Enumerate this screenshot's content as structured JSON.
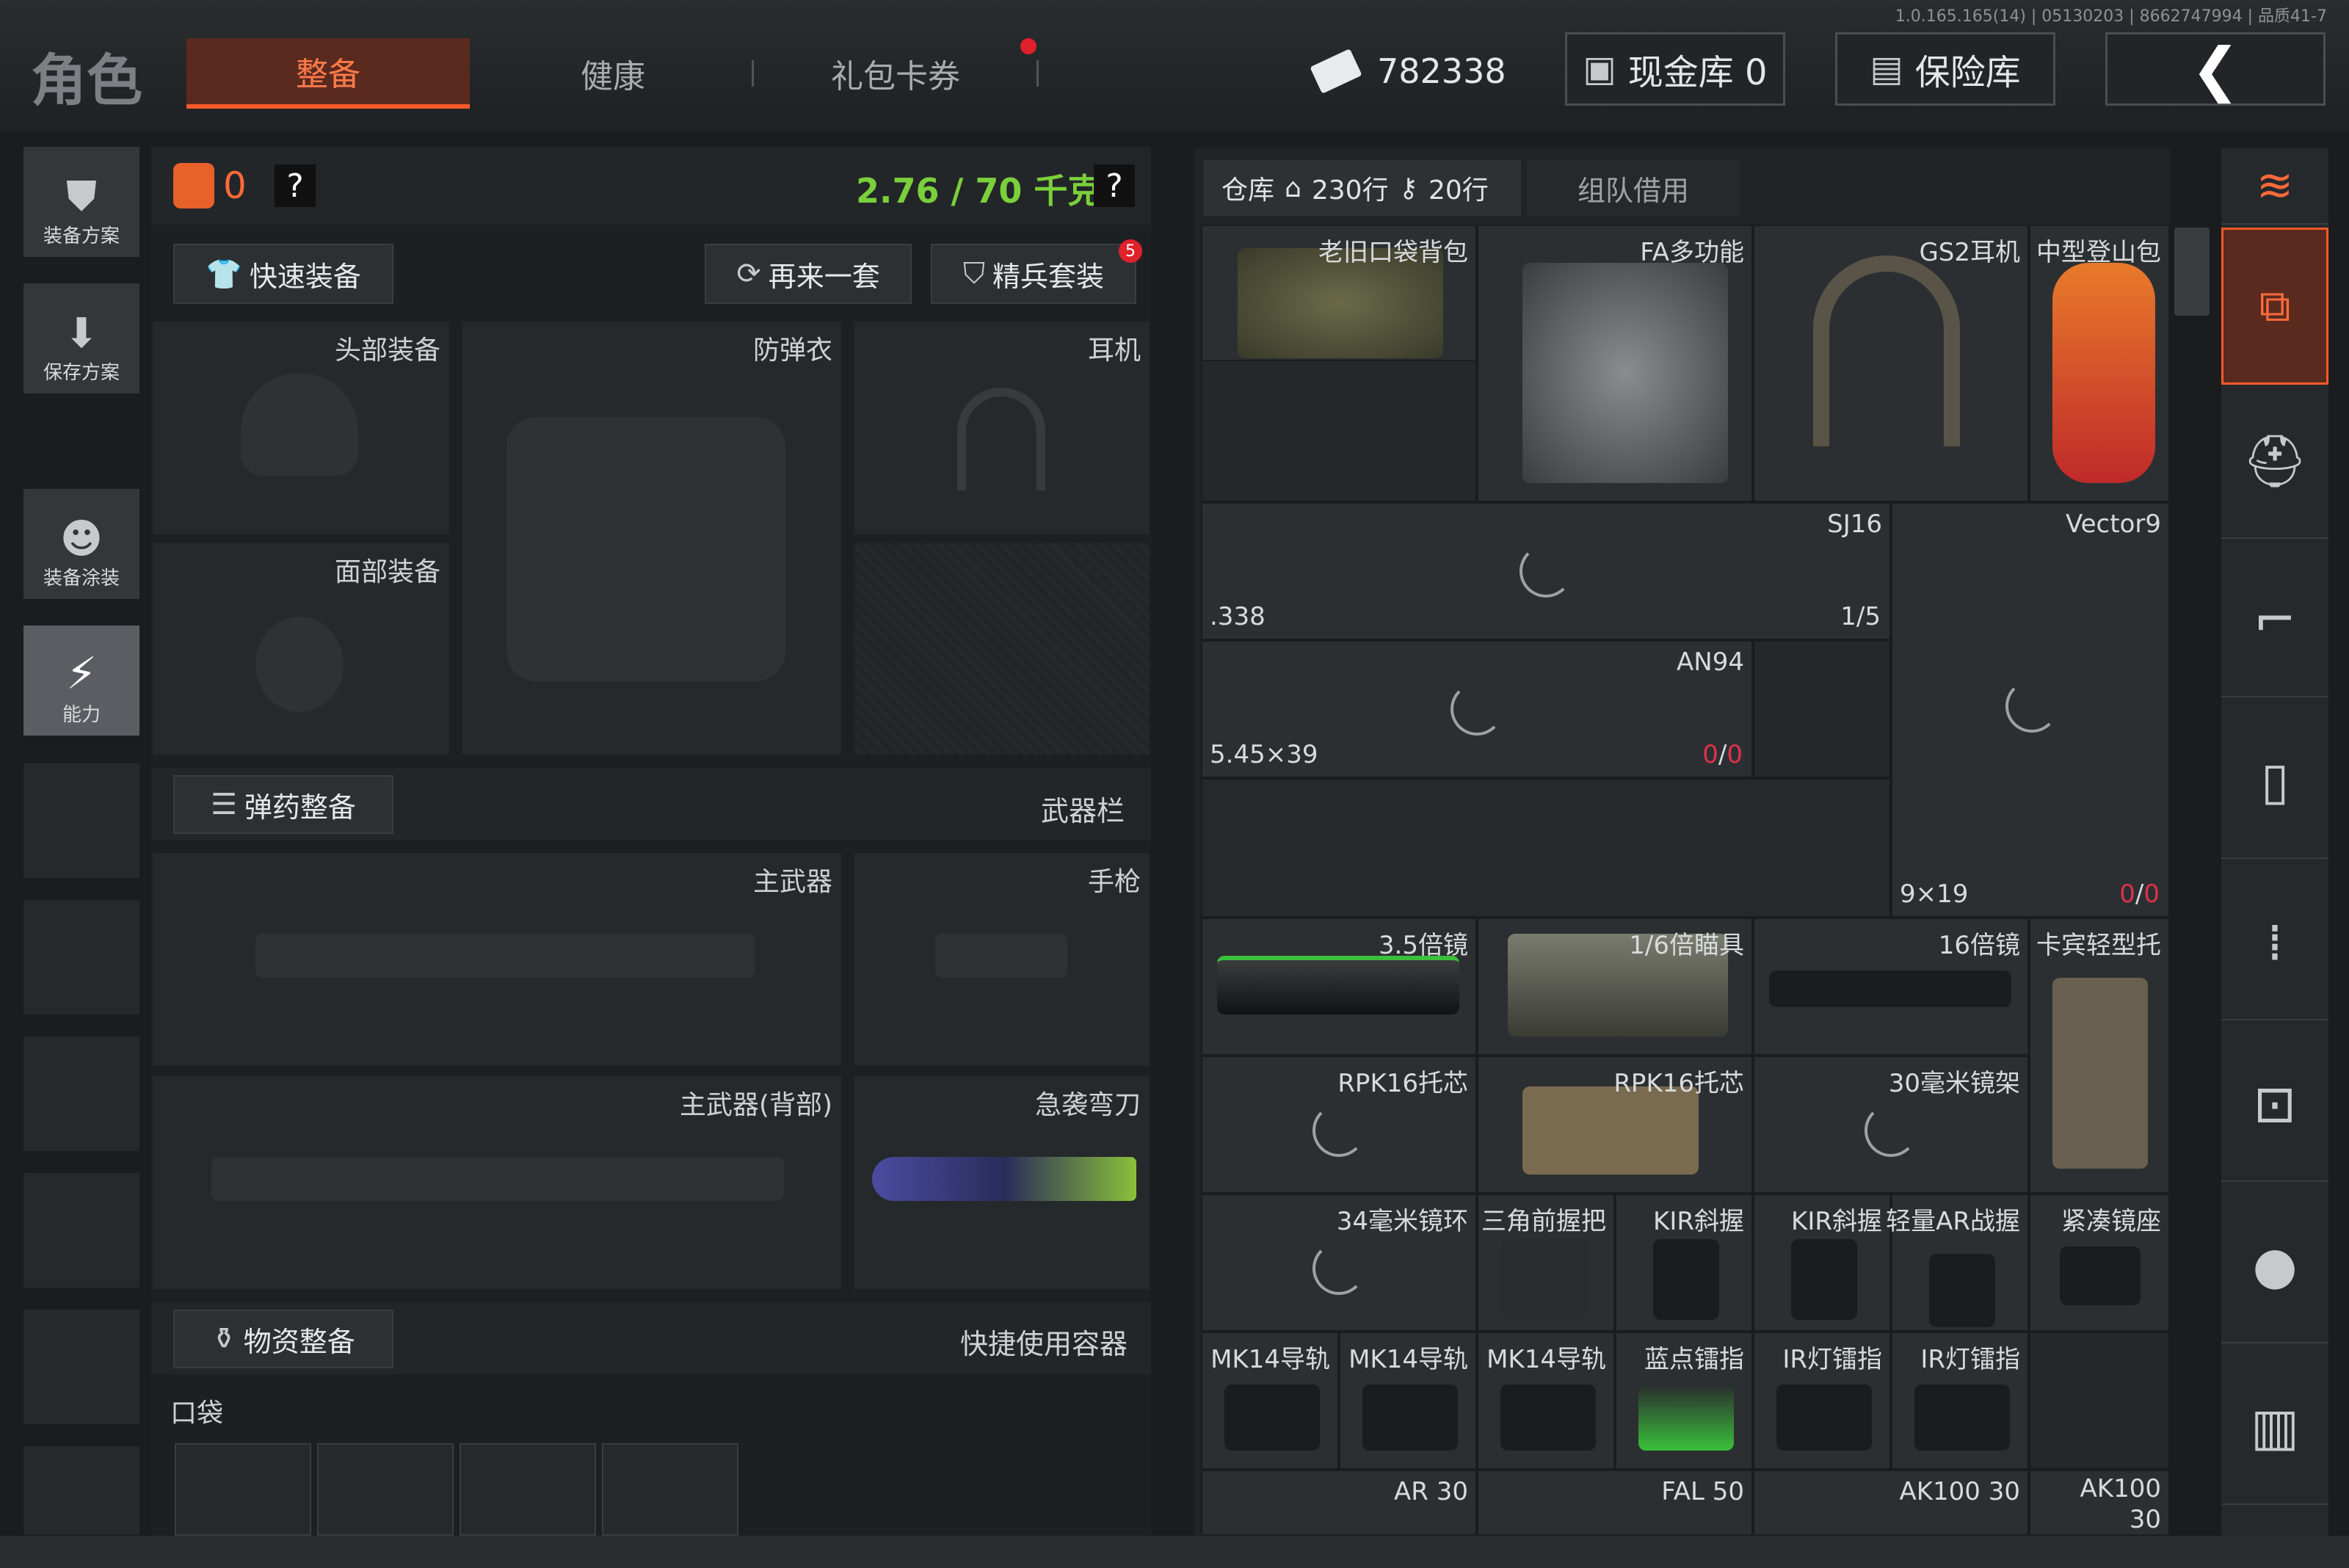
{
  "version": "1.0.165.165(14) | 05130203 | 8662747994 | 品质41-7",
  "header": {
    "role": "角色",
    "tabs": [
      "整备",
      "健康",
      "礼包卡券"
    ],
    "money": "782338",
    "cash_vault": "现金库 0",
    "safe": "保险库"
  },
  "left_nav": {
    "items": [
      "装备方案",
      "保存方案",
      "装备涂装",
      "能力"
    ]
  },
  "loadout": {
    "backpack_count": "0",
    "help": "?",
    "weight": "2.76 / 70 千克",
    "quick_equip": "快速装备",
    "another_set": "再来一套",
    "elite_set": "精兵套装",
    "elite_badge": "5",
    "slots": {
      "head": "头部装备",
      "armor": "防弹衣",
      "earphone": "耳机",
      "face": "面部装备"
    },
    "ammo_equip": "弹药整备",
    "weapon_bar": "武器栏",
    "primary": "主武器",
    "pistol": "手枪",
    "primary_back": "主武器(背部)",
    "melee": "急袭弯刀",
    "supply_equip": "物资整备",
    "quick_container": "快捷使用容器",
    "pocket": "口袋"
  },
  "warehouse": {
    "tab_main": "仓库",
    "rows_home": "230行",
    "rows_other": "20行",
    "tab_team": "组队借用",
    "items": {
      "old_bag": "老旧口袋背包",
      "fa": "FA多功能",
      "gs2": "GS2耳机",
      "mountain_bag": "中型登山包",
      "sj16": "SJ16",
      "sj16_count": "1/5",
      "cal338": ".338",
      "vector9": "Vector9",
      "an94": "AN94",
      "cal545": "5.45×39",
      "an94_ammo_a": "0",
      "an94_ammo_b": "0",
      "cal919": "9×19",
      "vec_ammo_a": "0",
      "vec_ammo_b": "0",
      "scope35": "3.5倍镜",
      "scope16x": "1/6倍瞄具",
      "scope16": "16倍镜",
      "kabin_stock": "卡宾轻型托",
      "rpk_stock_a": "RPK16托芯",
      "rpk_stock_b": "RPK16托芯",
      "mount30": "30毫米镜架",
      "ring34": "34毫米镜环",
      "tri_grip": "三角前握把",
      "kir_a": "KIR斜握",
      "kir_b": "KIR斜握",
      "ar_grip": "轻量AR战握",
      "compact_mount": "紧凑镜座",
      "mk14_a": "MK14导轨",
      "mk14_b": "MK14导轨",
      "mk14_c": "MK14导轨",
      "blue_dot": "蓝点镭指",
      "ir_a": "IR灯镭指",
      "ir_b": "IR灯镭指",
      "ar30": "AR 30",
      "fal50": "FAL 50",
      "ak100_30": "AK100 30",
      "ak100_b": "AK100",
      "ak100_b2": "30"
    }
  },
  "colors": {
    "accent": "#ff5a2a",
    "weight": "#7ad03a",
    "ammo_red": "#e0304a"
  }
}
